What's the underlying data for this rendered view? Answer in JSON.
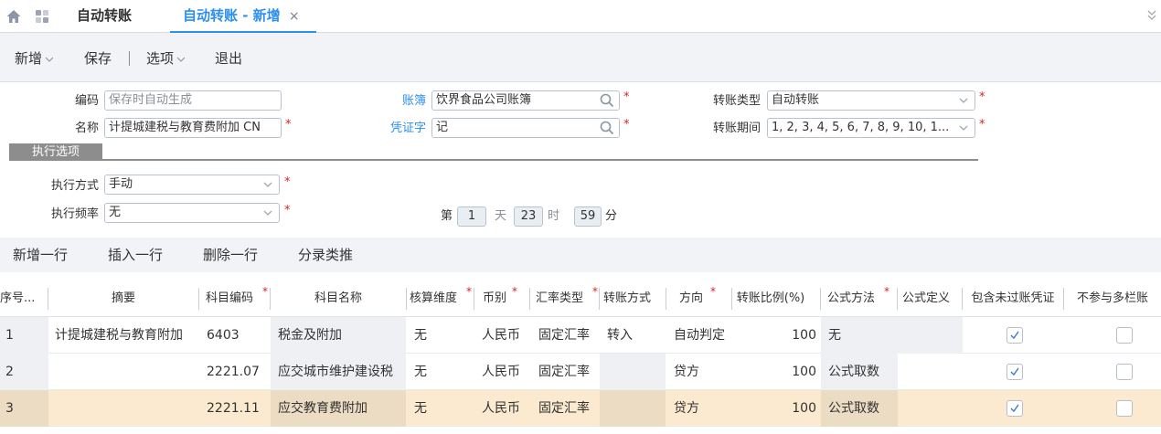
{
  "tabs": {
    "home_icon": "home-icon",
    "apps_icon": "apps-icon",
    "tab1": "自动转账",
    "tab2": "自动转账 - 新增",
    "tab2_close": "×"
  },
  "toolbar": {
    "new": "新增",
    "save": "保存",
    "sep": "|",
    "options": "选项",
    "exit": "退出"
  },
  "form": {
    "code_label": "编码",
    "code_placeholder": "保存时自动生成",
    "name_label": "名称",
    "name_value": "计提城建税与教育费附加 CN",
    "book_label": "账簿",
    "book_value": "饮界食品公司账簿",
    "voucher_label": "凭证字",
    "voucher_value": "记",
    "transfer_type_label": "转账类型",
    "transfer_type_value": "自动转账",
    "transfer_period_label": "转账期间",
    "transfer_period_value": "1, 2, 3, 4, 5, 6, 7, 8, 9, 10, 1...",
    "section": "执行选项",
    "exec_mode_label": "执行方式",
    "exec_mode_value": "手动",
    "exec_freq_label": "执行频率",
    "exec_freq_value": "无",
    "day_prefix": "第",
    "day_value": "1",
    "day_unit": "天",
    "hour_value": "23",
    "hour_unit": "时",
    "minute_value": "59",
    "minute_unit": "分",
    "required_mark": "*"
  },
  "grid_toolbar": {
    "add_row": "新增一行",
    "insert_row": "插入一行",
    "delete_row": "删除一行",
    "fill_down": "分录类推"
  },
  "grid": {
    "headers": [
      "序号...",
      "摘要",
      "科目编码",
      "科目名称",
      "核算维度",
      "币别",
      "汇率类型",
      "转账方式",
      "方向",
      "转账比例(%)",
      "公式方法",
      "公式定义",
      "包含未过账凭证",
      "不参与多栏账"
    ],
    "rows": [
      {
        "seq": "1",
        "summary": "计提城建税与教育附加",
        "account_code": "6403",
        "account_name": "税金及附加",
        "dimension": "无",
        "currency": "人民币",
        "rate_type": "固定汇率",
        "transfer_mode": "转入",
        "direction": "自动判定",
        "ratio": "100",
        "formula_method": "无",
        "formula_def": "",
        "include_unposted": true,
        "exclude_multicol": false
      },
      {
        "seq": "2",
        "summary": "",
        "account_code": "2221.07",
        "account_name": "应交城市维护建设税",
        "dimension": "无",
        "currency": "人民币",
        "rate_type": "固定汇率",
        "transfer_mode": "",
        "direction": "贷方",
        "ratio": "100",
        "formula_method": "公式取数",
        "formula_def": "",
        "include_unposted": true,
        "exclude_multicol": false
      },
      {
        "seq": "3",
        "summary": "",
        "account_code": "2221.11",
        "account_name": "应交教育费附加",
        "dimension": "无",
        "currency": "人民币",
        "rate_type": "固定汇率",
        "transfer_mode": "",
        "direction": "贷方",
        "ratio": "100",
        "formula_method": "公式取数",
        "formula_def": "",
        "include_unposted": true,
        "exclude_multicol": false
      }
    ],
    "selected_row": 3
  },
  "colors": {
    "accent": "#2d8ff0",
    "required": "#e02020",
    "selected_row": "#fbeacf",
    "section_tag": "#8d8d8d"
  }
}
